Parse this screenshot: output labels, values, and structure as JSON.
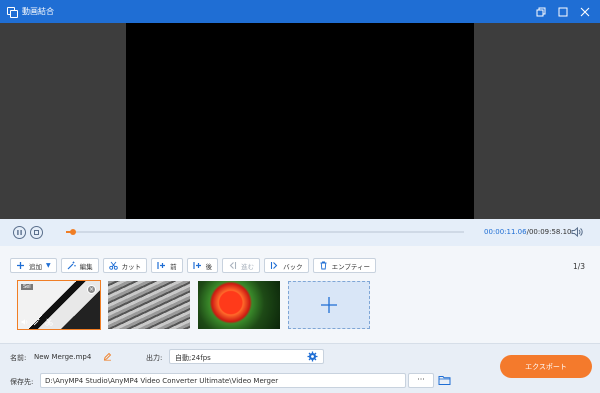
{
  "window": {
    "title": "動画結合",
    "icons": [
      "app-icon",
      "restore-icon",
      "maximize-icon",
      "close-icon"
    ]
  },
  "player": {
    "current_time": "00:00:11.06",
    "total_time": "00:09:58.10",
    "progress": 0.0185,
    "icons": [
      "pause-icon",
      "stop-icon",
      "volume-icon"
    ]
  },
  "toolbar": {
    "add_label": "追加",
    "edit_label": "編集",
    "cut_label": "カット",
    "before_label": "前",
    "after_label": "後",
    "forward_label": "進む",
    "back_label": "バック",
    "empty_label": "エンプティー",
    "page_indicator": "1/3"
  },
  "clips": {
    "items": [
      {
        "badge": "Sel",
        "selected": true
      },
      {
        "badge": "",
        "selected": false
      },
      {
        "badge": "",
        "selected": false
      }
    ],
    "icons": [
      "volume-icon",
      "effect-icon",
      "scissors-icon",
      "close-icon",
      "plus-icon"
    ]
  },
  "output": {
    "name_label": "名前:",
    "name_value": "New Merge.mp4",
    "output_label": "出力:",
    "output_value": "自動;24fps",
    "save_label": "保存先:",
    "save_path": "D:\\AnyMP4 Studio\\AnyMP4 Video Converter Ultimate\\Video Merger",
    "browse_label": "···",
    "export_label": "エクスポート"
  },
  "colors": {
    "accent_blue": "#1f6ed4",
    "accent_orange": "#f47a2c"
  }
}
